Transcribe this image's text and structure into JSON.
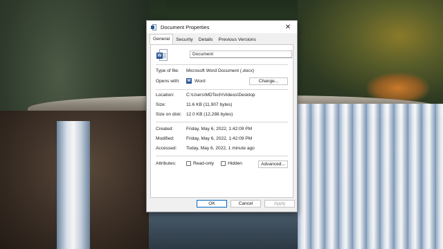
{
  "window": {
    "title": "Document Properties",
    "close_glyph": "✕"
  },
  "tabs": [
    {
      "label": "General",
      "active": true
    },
    {
      "label": "Security"
    },
    {
      "label": "Details"
    },
    {
      "label": "Previous Versions"
    }
  ],
  "file": {
    "icon": "word-document-icon",
    "name": "Document"
  },
  "type_section": {
    "type_label": "Type of file:",
    "type_value": "Microsoft Word Document (.docx)",
    "opens_label": "Opens with:",
    "opens_value": "Word",
    "opens_icon": "word-app-icon",
    "change_button": "Change..."
  },
  "location_section": {
    "location_label": "Location:",
    "location_value": "C:\\Users\\MDTech\\Videos\\Desktop",
    "size_label": "Size:",
    "size_value": "11.6 KB (11,907 bytes)",
    "size_on_disk_label": "Size on disk:",
    "size_on_disk_value": "12.0 KB (12,288 bytes)"
  },
  "dates_section": {
    "created_label": "Created:",
    "created_value": "Friday, May 6, 2022, 1:42:09 PM",
    "modified_label": "Modified:",
    "modified_value": "Friday, May 6, 2022, 1:42:09 PM",
    "accessed_label": "Accessed:",
    "accessed_value": "Today, May 6, 2022, 1 minute ago"
  },
  "attributes": {
    "label": "Attributes:",
    "read_only": {
      "label": "Read-only",
      "checked": false
    },
    "hidden": {
      "label": "Hidden",
      "checked": false
    },
    "advanced_button": "Advanced..."
  },
  "footer": {
    "ok": "OK",
    "cancel": "Cancel",
    "apply": "Apply"
  },
  "colors": {
    "accent": "#0067c0",
    "word_blue": "#2b5797"
  }
}
